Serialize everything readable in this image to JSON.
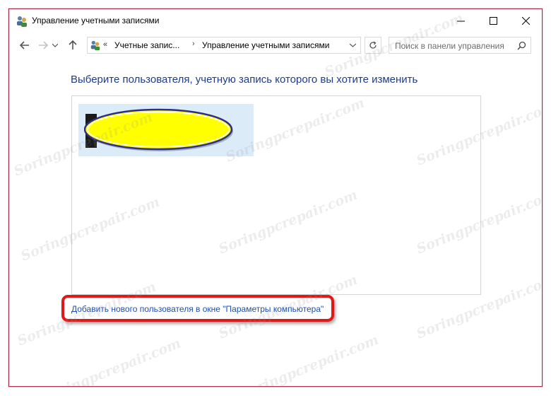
{
  "window": {
    "title": "Управление учетными записями",
    "border_color": "#b32a4a"
  },
  "controls": {
    "minimize_icon": "minimize-icon",
    "maximize_icon": "maximize-icon",
    "close_icon": "close-icon"
  },
  "nav": {
    "back_icon": "arrow-left-icon",
    "forward_icon": "arrow-right-icon",
    "recent_icon": "chevron-down-icon",
    "up_icon": "arrow-up-icon"
  },
  "address": {
    "overflow": "«",
    "crumbs": [
      "Учетные запис...",
      "Управление учетными записями"
    ],
    "separator": "›"
  },
  "search": {
    "placeholder": "Поиск в панели управления"
  },
  "content": {
    "heading": "Выберите пользователя, учетную запись которого вы хотите изменить",
    "heading_color": "#1e3c8c",
    "add_user_link": "Добавить нового пользователя в окне \"Параметры компьютера\"",
    "link_color": "#1b4fb0",
    "highlight_color": "#e01818",
    "redaction_color": "#ffff00"
  },
  "watermark": "Soringpcrepair.com"
}
